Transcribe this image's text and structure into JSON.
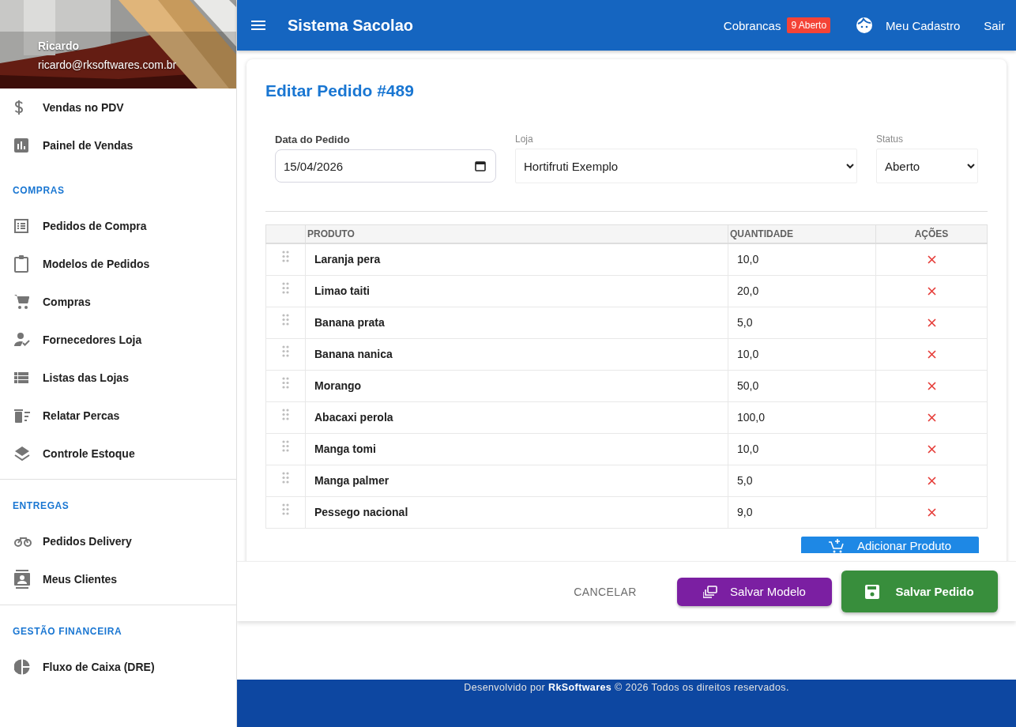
{
  "sidebar": {
    "user": {
      "name": "Ricardo",
      "email": "ricardo@rksoftwares.com.br"
    },
    "sections": [
      {
        "items": [
          {
            "label": "Vendas no PDV"
          },
          {
            "label": "Painel de Vendas"
          }
        ]
      },
      {
        "title": "COMPRAS",
        "items": [
          {
            "label": "Pedidos de Compra"
          },
          {
            "label": "Modelos de Pedidos"
          },
          {
            "label": "Compras"
          },
          {
            "label": "Fornecedores Loja"
          },
          {
            "label": "Listas das Lojas"
          },
          {
            "label": "Relatar Percas"
          },
          {
            "label": "Controle Estoque"
          }
        ]
      },
      {
        "title": "ENTREGAS",
        "items": [
          {
            "label": "Pedidos Delivery"
          },
          {
            "label": "Meus Clientes"
          }
        ]
      },
      {
        "title": "GESTÃO FINANCEIRA",
        "items": [
          {
            "label": "Fluxo de Caixa (DRE)"
          }
        ]
      }
    ]
  },
  "app_bar": {
    "title": "Sistema Sacolao",
    "billing": {
      "label": "Cobrancas",
      "badge": "9 Aberto"
    },
    "profile": "Meu Cadastro",
    "logout": "Sair"
  },
  "form": {
    "title": "Editar Pedido #489",
    "date": {
      "label": "Data do Pedido",
      "value": "15/04/2026"
    },
    "store": {
      "label": "Loja",
      "value": "Hortifruti Exemplo"
    },
    "status": {
      "label": "Status",
      "value": "Aberto"
    }
  },
  "table": {
    "columns": [
      "PRODUTO",
      "QUANTIDADE",
      "AÇÕES"
    ],
    "rows": [
      {
        "product": "Laranja pera",
        "quantity": "10,0"
      },
      {
        "product": "Limao taiti",
        "quantity": "20,0"
      },
      {
        "product": "Banana prata",
        "quantity": "5,0"
      },
      {
        "product": "Banana nanica",
        "quantity": "10,0"
      },
      {
        "product": "Morango",
        "quantity": "50,0"
      },
      {
        "product": "Abacaxi perola",
        "quantity": "100,0"
      },
      {
        "product": "Manga tomi",
        "quantity": "10,0"
      },
      {
        "product": "Manga palmer",
        "quantity": "5,0"
      },
      {
        "product": "Pessego nacional",
        "quantity": "9,0"
      }
    ]
  },
  "add_button": "Adicionar Produto",
  "actions": {
    "cancel": "CANCELAR",
    "save_template": "Salvar Modelo",
    "save_order": "Salvar Pedido"
  },
  "footer": {
    "prefix": "Desenvolvido por",
    "brand": "RkSoftwares",
    "suffix": "© 2026 Todos os direitos reservados."
  }
}
